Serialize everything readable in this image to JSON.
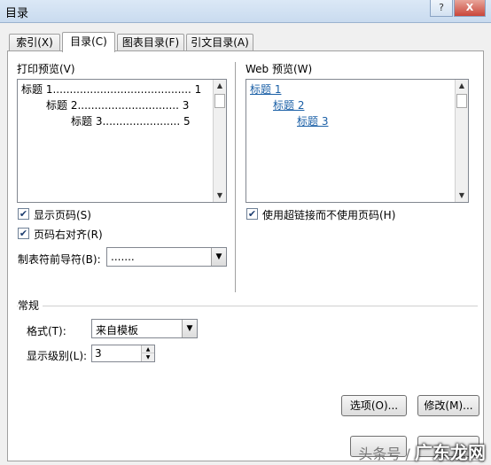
{
  "window": {
    "title": "目录",
    "help_label": "?",
    "close_label": "X"
  },
  "tabs": [
    {
      "label": "索引(X)",
      "active": false
    },
    {
      "label": "目录(C)",
      "active": true
    },
    {
      "label": "图表目录(F)",
      "active": false
    },
    {
      "label": "引文目录(A)",
      "active": false
    }
  ],
  "print_preview": {
    "label": "打印预览(V)",
    "entries": [
      {
        "text": "标题 1......................................... 1"
      },
      {
        "text": "标题 2.............................. 3"
      },
      {
        "text": "标题 3....................... 5"
      }
    ]
  },
  "web_preview": {
    "label": "Web 预览(W)",
    "entries": [
      "标题 1",
      "标题 2",
      "标题 3"
    ]
  },
  "options": {
    "show_page_numbers": {
      "label": "显示页码(S)",
      "checked": true
    },
    "right_align": {
      "label": "页码右对齐(R)",
      "checked": true
    },
    "use_hyperlinks": {
      "label": "使用超链接而不使用页码(H)",
      "checked": true
    },
    "tab_leader": {
      "label": "制表符前导符(B):",
      "value": "......."
    }
  },
  "general": {
    "section_label": "常规",
    "format": {
      "label": "格式(T):",
      "value": "来自模板"
    },
    "show_levels": {
      "label": "显示级别(L):",
      "value": "3"
    }
  },
  "buttons": {
    "options_label": "选项(O)...",
    "modify_label": "修改(M)..."
  },
  "watermark": {
    "prefix": "头条号 / ",
    "brand": "广东龙网"
  },
  "icons": {
    "check": "check-mark",
    "dropdown": "dropdown-arrow-icon"
  }
}
